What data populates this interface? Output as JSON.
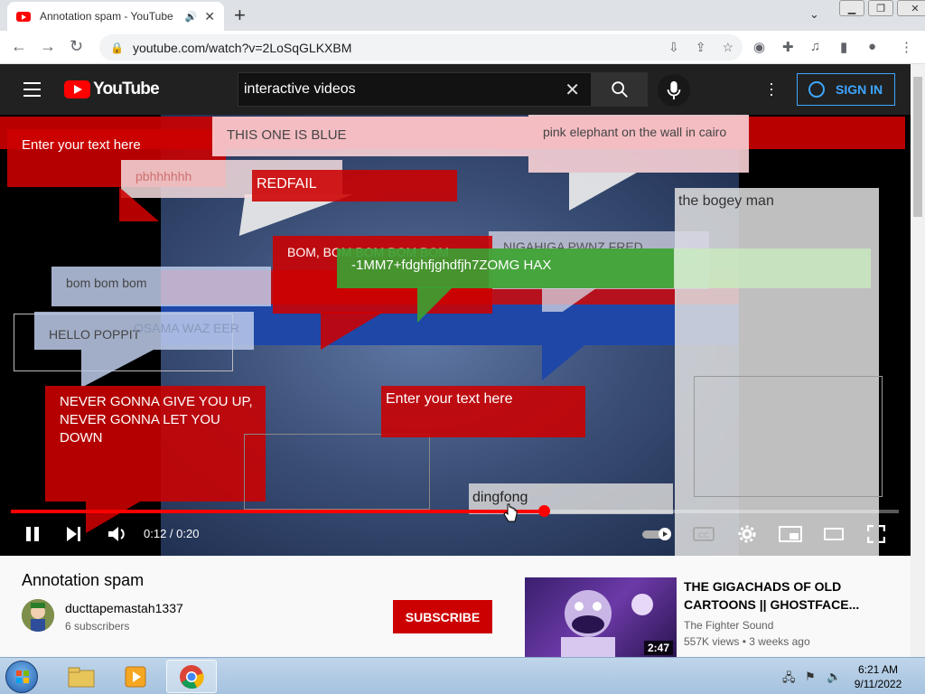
{
  "browser": {
    "tab_title": "Annotation spam - YouTube",
    "url": "youtube.com/watch?v=2LoSqGLKXBM"
  },
  "youtube": {
    "logo_text": "YouTube",
    "search_query": "interactive videos",
    "sign_in": "SIGN IN"
  },
  "annotations": [
    "Enter your text here",
    "THIS ONE IS BLUE",
    "pink elephant on the wall in cairo",
    "pbhhhhhh",
    "REDFAIL",
    "the bogey man",
    "BOM, BOM BOM BOM BOM",
    "NIGAHIGA PWNZ FRED",
    "-1MM7+fdghfjghdfjh7ZOMG HAX",
    "bom bom bom",
    "OSAMA WAZ EER",
    "HELLO POPPIT",
    "NEVER GONNA GIVE YOU UP, NEVER GONNA LET YOU DOWN",
    "Enter your text here",
    "dingfong"
  ],
  "player": {
    "time_current": "0:12",
    "time_total": "0:20",
    "time_display": "0:12 / 0:20",
    "progress_fraction": 0.6
  },
  "video": {
    "title": "Annotation spam",
    "channel": "ducttapemastah1337",
    "subscribers": "6 subscribers",
    "subscribe": "SUBSCRIBE"
  },
  "recommended": {
    "title": "THE GIGACHADS OF OLD CARTOONS || GHOSTFACE...",
    "channel": "The Fighter Sound",
    "meta": "557K views • 3 weeks ago",
    "duration": "2:47"
  },
  "taskbar": {
    "time": "6:21 AM",
    "date": "9/11/2022"
  },
  "colors": {
    "yt_red": "#ff0000",
    "annotation_red": "#cd0000",
    "signin_blue": "#3ea6ff",
    "yt_header": "#212121"
  }
}
